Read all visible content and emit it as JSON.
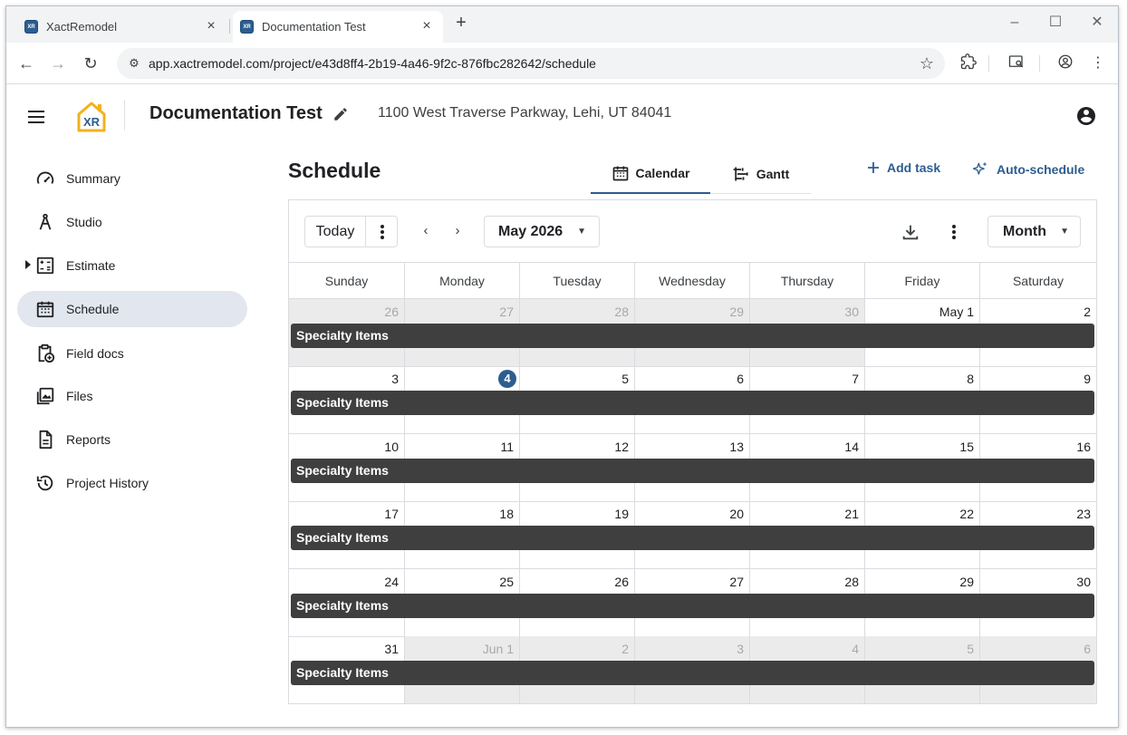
{
  "browser": {
    "tabs": [
      {
        "title": "XactRemodel",
        "favicon": "XR"
      },
      {
        "title": "Documentation Test",
        "favicon": "XR"
      }
    ],
    "url": "app.xactremodel.com/project/e43d8ff4-2b19-4a46-9f2c-876fbc282642/schedule"
  },
  "header": {
    "logo_text": "XR",
    "project_title": "Documentation Test",
    "address": "1100 West Traverse Parkway, Lehi, UT 84041"
  },
  "sidebar": {
    "items": [
      {
        "label": "Summary",
        "icon": "speedometer-icon"
      },
      {
        "label": "Studio",
        "icon": "compass-icon"
      },
      {
        "label": "Estimate",
        "icon": "calculator-icon"
      },
      {
        "label": "Schedule",
        "icon": "calendar-icon",
        "active": true
      },
      {
        "label": "Field docs",
        "icon": "clipboard-add-icon"
      },
      {
        "label": "Files",
        "icon": "photo-library-icon"
      },
      {
        "label": "Reports",
        "icon": "document-icon"
      },
      {
        "label": "Project History",
        "icon": "history-icon"
      }
    ]
  },
  "main": {
    "title": "Schedule",
    "view_tabs": [
      {
        "label": "Calendar",
        "active": true
      },
      {
        "label": "Gantt"
      }
    ],
    "actions": {
      "add_task": "Add task",
      "auto_schedule": "Auto-schedule"
    }
  },
  "calendar": {
    "today_label": "Today",
    "month_label": "May 2026",
    "view_label": "Month",
    "weekdays": [
      "Sunday",
      "Monday",
      "Tuesday",
      "Wednesday",
      "Thursday",
      "Friday",
      "Saturday"
    ],
    "weeks": [
      [
        {
          "d": "26",
          "out": true
        },
        {
          "d": "27",
          "out": true
        },
        {
          "d": "28",
          "out": true
        },
        {
          "d": "29",
          "out": true
        },
        {
          "d": "30",
          "out": true
        },
        {
          "d": "May 1"
        },
        {
          "d": "2"
        }
      ],
      [
        {
          "d": "3"
        },
        {
          "d": "4",
          "today": true
        },
        {
          "d": "5"
        },
        {
          "d": "6"
        },
        {
          "d": "7"
        },
        {
          "d": "8"
        },
        {
          "d": "9"
        }
      ],
      [
        {
          "d": "10"
        },
        {
          "d": "11"
        },
        {
          "d": "12"
        },
        {
          "d": "13"
        },
        {
          "d": "14"
        },
        {
          "d": "15"
        },
        {
          "d": "16"
        }
      ],
      [
        {
          "d": "17"
        },
        {
          "d": "18"
        },
        {
          "d": "19"
        },
        {
          "d": "20"
        },
        {
          "d": "21"
        },
        {
          "d": "22"
        },
        {
          "d": "23"
        }
      ],
      [
        {
          "d": "24"
        },
        {
          "d": "25"
        },
        {
          "d": "26"
        },
        {
          "d": "27"
        },
        {
          "d": "28"
        },
        {
          "d": "29"
        },
        {
          "d": "30"
        }
      ],
      [
        {
          "d": "31"
        },
        {
          "d": "Jun 1",
          "out": true
        },
        {
          "d": "2",
          "out": true
        },
        {
          "d": "3",
          "out": true
        },
        {
          "d": "4",
          "out": true
        },
        {
          "d": "5",
          "out": true
        },
        {
          "d": "6",
          "out": true
        }
      ]
    ],
    "event_label": "Specialty Items",
    "colors": {
      "accent": "#2c5d8f",
      "event": "#3f3f3f",
      "out_of_month": "#ebebeb"
    }
  }
}
